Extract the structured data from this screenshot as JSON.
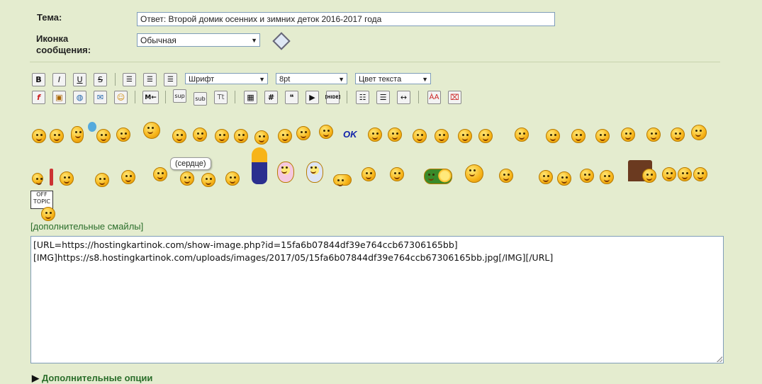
{
  "form": {
    "subject_label": "Тема:",
    "subject_value": "Ответ: Второй домик осенних и зимних деток 2016-2017 года",
    "icon_label_line1": "Иконка",
    "icon_label_line2": "сообщения:",
    "icon_select_value": "Обычная"
  },
  "toolbar": {
    "font_select": "Шрифт",
    "size_select": "8pt",
    "color_select": "Цвет текста",
    "bold": "B",
    "italic": "I",
    "underline": "U",
    "strike": "S",
    "sup": "sup",
    "sub": "sub",
    "tt": "Tt",
    "hash": "#",
    "hide": "[HIDE]",
    "move": "M←"
  },
  "smiles": {
    "tooltip": "(сердце)",
    "offtopic_line1": "OFF",
    "offtopic_line2": "TOPIC",
    "ok_text": "OK",
    "more_link": "[дополнительные смайлы]"
  },
  "editor": {
    "text": "[URL=https://hostingkartinok.com/show-image.php?id=15fa6b07844df39e764ccb67306165bb]\n[IMG]https://s8.hostingkartinok.com/uploads/images/2017/05/15fa6b07844df39e764ccb67306165bb.jpg[/IMG][/URL]"
  },
  "footer": {
    "additional_options": "Дополнительные опции"
  }
}
